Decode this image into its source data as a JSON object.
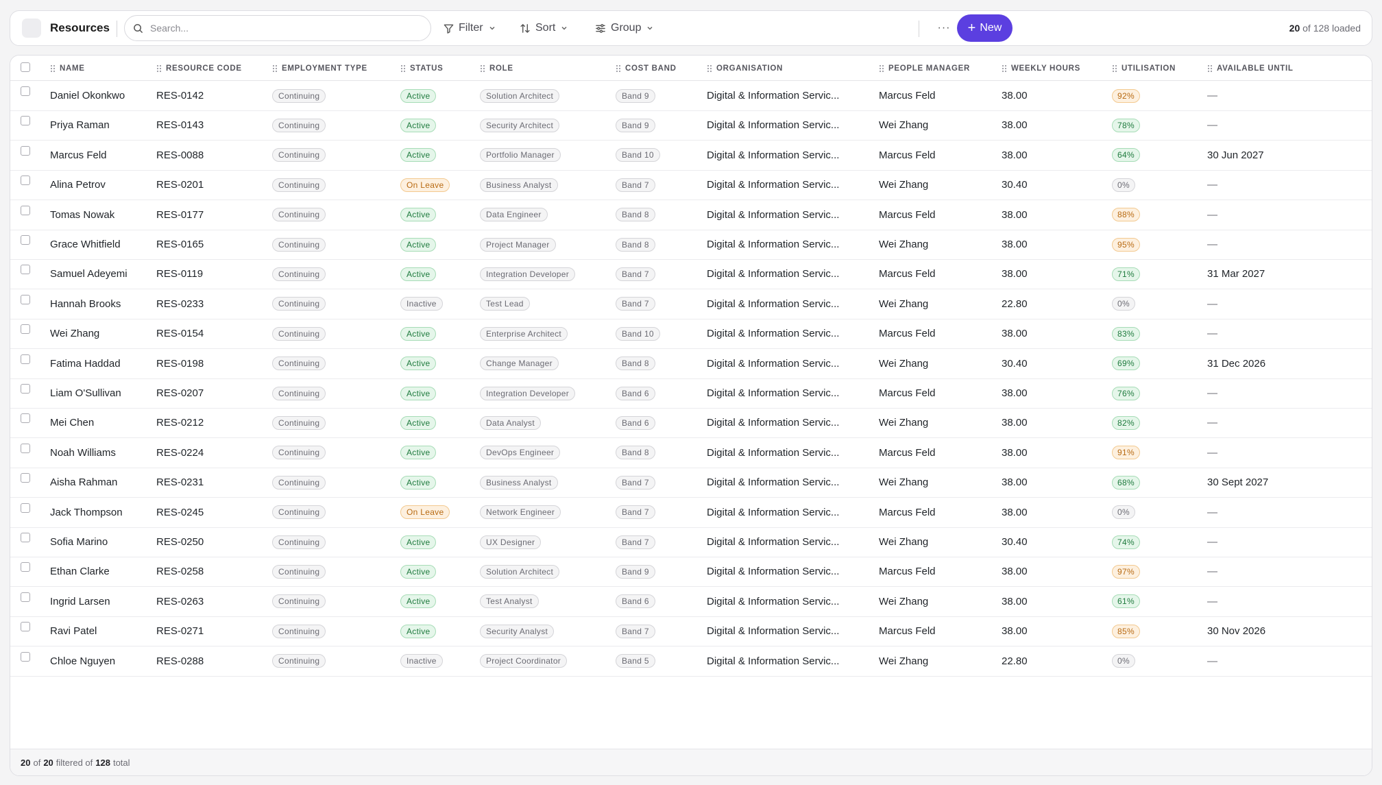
{
  "app": {
    "title": "Resources"
  },
  "search": {
    "placeholder": "Search..."
  },
  "toolbar": {
    "filter_label": "Filter",
    "sort_label": "Sort",
    "group_label": "Group",
    "more_label": "···",
    "new_label": "New",
    "loaded_count": "20",
    "loaded_of": "of",
    "loaded_total": "128",
    "loaded_suffix": "loaded"
  },
  "colors": {
    "accent": "#5b3fe0",
    "status_active": "#1e7a3d",
    "status_on_leave": "#b86a12",
    "status_inactive": "#6a6a72"
  },
  "columns": [
    {
      "key": "name",
      "label": "Name"
    },
    {
      "key": "code",
      "label": "Resource Code"
    },
    {
      "key": "employment",
      "label": "Employment Type"
    },
    {
      "key": "status",
      "label": "Status"
    },
    {
      "key": "role",
      "label": "Role"
    },
    {
      "key": "band",
      "label": "Cost Band"
    },
    {
      "key": "org",
      "label": "Organisation"
    },
    {
      "key": "manager",
      "label": "People Manager"
    },
    {
      "key": "hours",
      "label": "Weekly Hours"
    },
    {
      "key": "util",
      "label": "Utilisation"
    },
    {
      "key": "until",
      "label": "Available Until"
    }
  ],
  "rows": [
    {
      "name": "Daniel Okonkwo",
      "code": "RES-0142",
      "employment": "Continuing",
      "status": "Active",
      "role": "Solution Architect",
      "band": "Band 9",
      "org": "Digital & Information Servic...",
      "manager": "Marcus Feld",
      "hours": "38.00",
      "util": "92%",
      "until": "—"
    },
    {
      "name": "Priya Raman",
      "code": "RES-0143",
      "employment": "Continuing",
      "status": "Active",
      "role": "Security Architect",
      "band": "Band 9",
      "org": "Digital & Information Servic...",
      "manager": "Wei Zhang",
      "hours": "38.00",
      "util": "78%",
      "until": "—"
    },
    {
      "name": "Marcus Feld",
      "code": "RES-0088",
      "employment": "Continuing",
      "status": "Active",
      "role": "Portfolio Manager",
      "band": "Band 10",
      "org": "Digital & Information Servic...",
      "manager": "Marcus Feld",
      "hours": "38.00",
      "util": "64%",
      "until": "30 Jun 2027"
    },
    {
      "name": "Alina Petrov",
      "code": "RES-0201",
      "employment": "Continuing",
      "status": "On Leave",
      "role": "Business Analyst",
      "band": "Band 7",
      "org": "Digital & Information Servic...",
      "manager": "Wei Zhang",
      "hours": "30.40",
      "util": "0%",
      "until": "—"
    },
    {
      "name": "Tomas Nowak",
      "code": "RES-0177",
      "employment": "Continuing",
      "status": "Active",
      "role": "Data Engineer",
      "band": "Band 8",
      "org": "Digital & Information Servic...",
      "manager": "Marcus Feld",
      "hours": "38.00",
      "util": "88%",
      "until": "—"
    },
    {
      "name": "Grace Whitfield",
      "code": "RES-0165",
      "employment": "Continuing",
      "status": "Active",
      "role": "Project Manager",
      "band": "Band 8",
      "org": "Digital & Information Servic...",
      "manager": "Wei Zhang",
      "hours": "38.00",
      "util": "95%",
      "until": "—"
    },
    {
      "name": "Samuel Adeyemi",
      "code": "RES-0119",
      "employment": "Continuing",
      "status": "Active",
      "role": "Integration Developer",
      "band": "Band 7",
      "org": "Digital & Information Servic...",
      "manager": "Marcus Feld",
      "hours": "38.00",
      "util": "71%",
      "until": "31 Mar 2027"
    },
    {
      "name": "Hannah Brooks",
      "code": "RES-0233",
      "employment": "Continuing",
      "status": "Inactive",
      "role": "Test Lead",
      "band": "Band 7",
      "org": "Digital & Information Servic...",
      "manager": "Wei Zhang",
      "hours": "22.80",
      "util": "0%",
      "until": "—"
    },
    {
      "name": "Wei Zhang",
      "code": "RES-0154",
      "employment": "Continuing",
      "status": "Active",
      "role": "Enterprise Architect",
      "band": "Band 10",
      "org": "Digital & Information Servic...",
      "manager": "Marcus Feld",
      "hours": "38.00",
      "util": "83%",
      "until": "—"
    },
    {
      "name": "Fatima Haddad",
      "code": "RES-0198",
      "employment": "Continuing",
      "status": "Active",
      "role": "Change Manager",
      "band": "Band 8",
      "org": "Digital & Information Servic...",
      "manager": "Wei Zhang",
      "hours": "30.40",
      "util": "69%",
      "until": "31 Dec 2026"
    },
    {
      "name": "Liam O'Sullivan",
      "code": "RES-0207",
      "employment": "Continuing",
      "status": "Active",
      "role": "Integration Developer",
      "band": "Band 6",
      "org": "Digital & Information Servic...",
      "manager": "Marcus Feld",
      "hours": "38.00",
      "util": "76%",
      "until": "—"
    },
    {
      "name": "Mei Chen",
      "code": "RES-0212",
      "employment": "Continuing",
      "status": "Active",
      "role": "Data Analyst",
      "band": "Band 6",
      "org": "Digital & Information Servic...",
      "manager": "Wei Zhang",
      "hours": "38.00",
      "util": "82%",
      "until": "—"
    },
    {
      "name": "Noah Williams",
      "code": "RES-0224",
      "employment": "Continuing",
      "status": "Active",
      "role": "DevOps Engineer",
      "band": "Band 8",
      "org": "Digital & Information Servic...",
      "manager": "Marcus Feld",
      "hours": "38.00",
      "util": "91%",
      "until": "—"
    },
    {
      "name": "Aisha Rahman",
      "code": "RES-0231",
      "employment": "Continuing",
      "status": "Active",
      "role": "Business Analyst",
      "band": "Band 7",
      "org": "Digital & Information Servic...",
      "manager": "Wei Zhang",
      "hours": "38.00",
      "util": "68%",
      "until": "30 Sept 2027"
    },
    {
      "name": "Jack Thompson",
      "code": "RES-0245",
      "employment": "Continuing",
      "status": "On Leave",
      "role": "Network Engineer",
      "band": "Band 7",
      "org": "Digital & Information Servic...",
      "manager": "Marcus Feld",
      "hours": "38.00",
      "util": "0%",
      "until": "—"
    },
    {
      "name": "Sofia Marino",
      "code": "RES-0250",
      "employment": "Continuing",
      "status": "Active",
      "role": "UX Designer",
      "band": "Band 7",
      "org": "Digital & Information Servic...",
      "manager": "Wei Zhang",
      "hours": "30.40",
      "util": "74%",
      "until": "—"
    },
    {
      "name": "Ethan Clarke",
      "code": "RES-0258",
      "employment": "Continuing",
      "status": "Active",
      "role": "Solution Architect",
      "band": "Band 9",
      "org": "Digital & Information Servic...",
      "manager": "Marcus Feld",
      "hours": "38.00",
      "util": "97%",
      "until": "—"
    },
    {
      "name": "Ingrid Larsen",
      "code": "RES-0263",
      "employment": "Continuing",
      "status": "Active",
      "role": "Test Analyst",
      "band": "Band 6",
      "org": "Digital & Information Servic...",
      "manager": "Wei Zhang",
      "hours": "38.00",
      "util": "61%",
      "until": "—"
    },
    {
      "name": "Ravi Patel",
      "code": "RES-0271",
      "employment": "Continuing",
      "status": "Active",
      "role": "Security Analyst",
      "band": "Band 7",
      "org": "Digital & Information Servic...",
      "manager": "Marcus Feld",
      "hours": "38.00",
      "util": "85%",
      "until": "30 Nov 2026"
    },
    {
      "name": "Chloe Nguyen",
      "code": "RES-0288",
      "employment": "Continuing",
      "status": "Inactive",
      "role": "Project Coordinator",
      "band": "Band 5",
      "org": "Digital & Information Servic...",
      "manager": "Wei Zhang",
      "hours": "22.80",
      "util": "0%",
      "until": "—"
    }
  ],
  "footer": {
    "shown": "20",
    "of_word": "of",
    "filtered": "20",
    "filtered_of_word": "filtered of",
    "total": "128",
    "total_word": "total"
  }
}
